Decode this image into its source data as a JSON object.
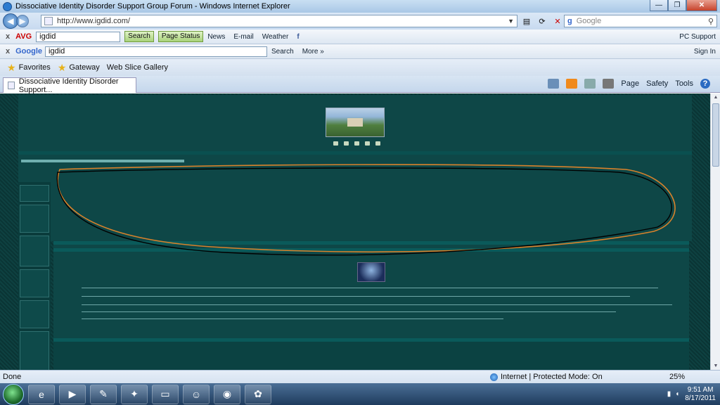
{
  "window": {
    "title": "Dissociative Identity Disorder Support Group Forum - Windows Internet Explorer",
    "min_glyph": "—",
    "max_glyph": "❐",
    "close_glyph": "✕"
  },
  "address_bar": {
    "url": "http://www.igdid.com/",
    "search_placeholder": "Google",
    "search_engine_glyph": "g"
  },
  "avg_toolbar": {
    "close_glyph": "x",
    "brand": "AVG",
    "search_value": "igdid",
    "search_button": "Search",
    "page_status": "Page Status",
    "news": "News",
    "email": "E-mail",
    "weather": "Weather",
    "pc_support": "PC Support"
  },
  "google_toolbar": {
    "close_glyph": "x",
    "brand": "Google",
    "search_value": "igdid",
    "search_button": "Search",
    "more": "More »",
    "sign_in": "Sign In"
  },
  "favorites_bar": {
    "favorites": "Favorites",
    "gateway": "Gateway",
    "web_slice": "Web Slice Gallery"
  },
  "tab": {
    "label": "Dissociative Identity Disorder Support..."
  },
  "command_bar": {
    "page": "Page",
    "safety": "Safety",
    "tools": "Tools",
    "help_glyph": "?"
  },
  "status_bar": {
    "left": "Done",
    "zone": "Internet | Protected Mode: On",
    "zoom": "25%"
  },
  "taskbar": {
    "time": "9:51 AM",
    "date": "8/17/2011"
  },
  "icons": {
    "back": "arrow-left-icon",
    "forward": "arrow-right-icon",
    "refresh": "refresh-icon",
    "stop": "stop-icon",
    "search": "magnifier-icon",
    "home": "home-icon",
    "rss": "rss-icon",
    "print": "print-icon"
  },
  "colors": {
    "page_bg": "#0c3b3b",
    "accent_red": "#cc0000",
    "annotation_orange": "#d9822b",
    "annotation_black": "#000000"
  }
}
